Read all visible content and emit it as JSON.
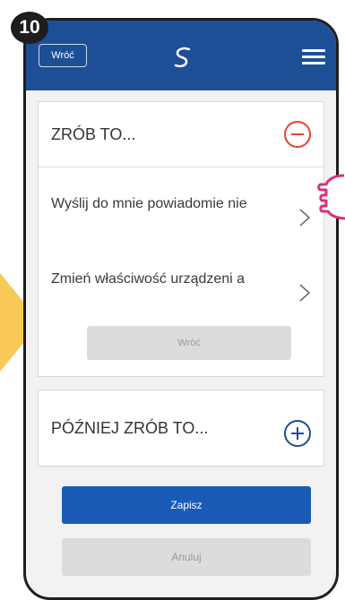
{
  "step": {
    "number": "10"
  },
  "topbar": {
    "back_label": "Wróć",
    "logo_icon": "swirl-logo-icon",
    "menu_icon": "hamburger-menu-icon"
  },
  "do_this": {
    "title": "ZRÓB TO...",
    "collapse_icon": "minus-circle-icon",
    "options": [
      {
        "label": "Wyślij do mnie powiadomie nie",
        "icon": "chevron-right-icon"
      },
      {
        "label": "Zmień właściwość urządzeni a",
        "icon": "chevron-right-icon"
      }
    ],
    "back_label": "Wróć"
  },
  "later_do_this": {
    "title": "PÓŹNIEJ ZRÓB TO...",
    "expand_icon": "plus-circle-icon"
  },
  "actions": {
    "save_label": "Zapisz",
    "cancel_label": "Anuluj"
  },
  "colors": {
    "topbar": "#1c4f96",
    "primary": "#1a5bb8",
    "remove_accent": "#e8412c",
    "highlight_arrow": "#f9c956",
    "pointer": "#d6337a"
  }
}
